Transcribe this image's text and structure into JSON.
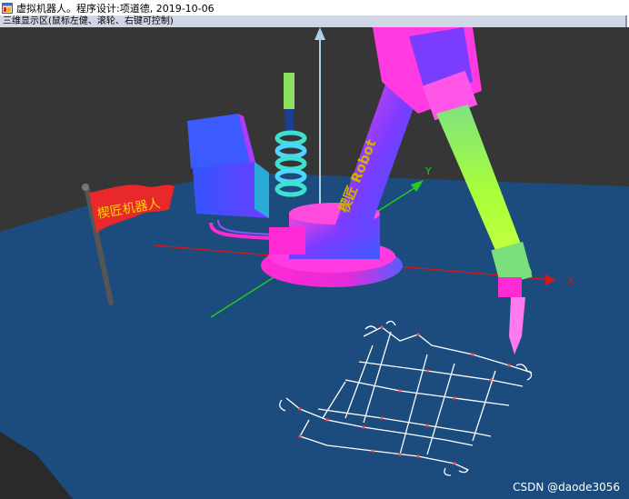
{
  "window": {
    "title": "虚拟机器人。程序设计:项道德, 2019-10-06",
    "icon": "app-window-icon"
  },
  "viewport_panel": {
    "label": "三维显示区(鼠标左健、滚轮、右键可控制)"
  },
  "scene": {
    "flag_text": "楔匠机器人",
    "arm_text": "楔匠 Robot",
    "axis_x_label": "X",
    "axis_y_label": "Y"
  },
  "watermark": "CSDN @daode3056",
  "colors": {
    "floor": "#1c4c7d",
    "background": "#363636",
    "magenta": "#ff2ad4",
    "violet": "#6a3dff",
    "flag_red": "#e8282a",
    "axis_red": "#d01818",
    "axis_green": "#22cc22"
  }
}
